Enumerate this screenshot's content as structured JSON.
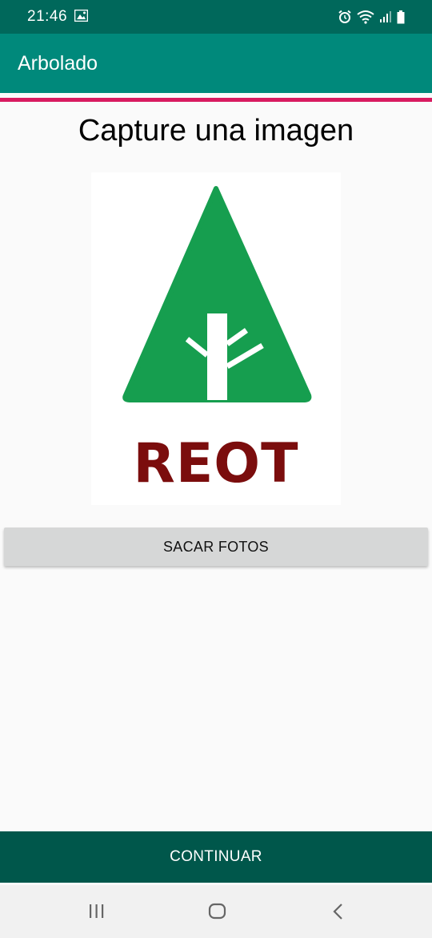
{
  "status_bar": {
    "time": "21:46",
    "icons": [
      "gallery-icon",
      "alarm-icon",
      "wifi-icon",
      "signal-icon",
      "battery-icon"
    ]
  },
  "app_bar": {
    "title": "Arbolado"
  },
  "main": {
    "heading": "Capture una imagen",
    "logo": {
      "text": "REOT",
      "tree_color": "#169e4f",
      "text_color": "#7b0d0d"
    },
    "take_photo_label": "SACAR FOTOS"
  },
  "footer": {
    "continue_label": "CONTINUAR"
  },
  "nav_bar": {
    "icons": [
      "recents-icon",
      "home-icon",
      "back-icon"
    ]
  },
  "colors": {
    "status_bar": "#00685b",
    "app_bar": "#00897b",
    "accent": "#d81b60",
    "continue_button": "#00574b",
    "secondary_button": "#d6d7d7"
  }
}
